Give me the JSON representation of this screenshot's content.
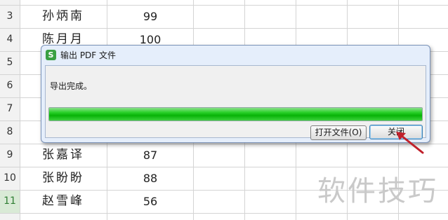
{
  "sheet": {
    "rows": [
      {
        "num": "",
        "name": "",
        "score": ""
      },
      {
        "num": "3",
        "name": "孙炳南",
        "score": "99"
      },
      {
        "num": "4",
        "name": "陈月月",
        "score": "100"
      },
      {
        "num": "5",
        "name": "",
        "score": ""
      },
      {
        "num": "6",
        "name": "",
        "score": ""
      },
      {
        "num": "7",
        "name": "",
        "score": ""
      },
      {
        "num": "8",
        "name": "",
        "score": ""
      },
      {
        "num": "9",
        "name": "张嘉译",
        "score": "87"
      },
      {
        "num": "10",
        "name": "张盼盼",
        "score": "88"
      },
      {
        "num": "11",
        "name": "赵雪峰",
        "score": "56"
      }
    ],
    "active_row": "11"
  },
  "dialog": {
    "title": "输出 PDF 文件",
    "message": "导出完成。",
    "progress": 1.0,
    "open_button": "打开文件(O)",
    "close_button": "关闭"
  },
  "watermark": "软件技巧",
  "colors": {
    "progress": "#07b307",
    "arrow": "#c0202a",
    "active_row": "#2e7d32"
  }
}
